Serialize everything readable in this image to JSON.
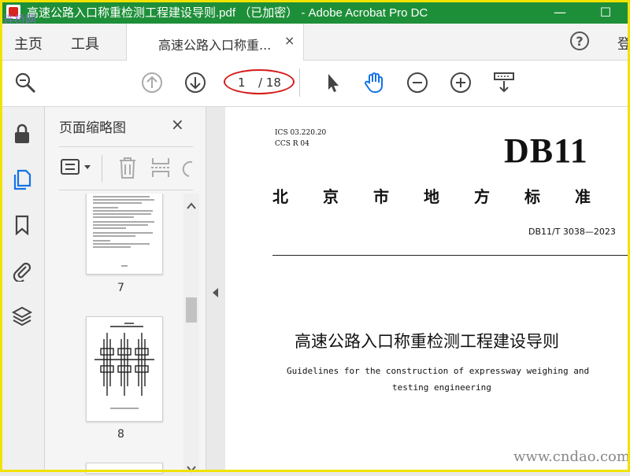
{
  "window": {
    "title": "高速公路入口称重检测工程建设导则.pdf （已加密） - Adobe Acrobat Pro DC",
    "minimize_glyph": "—",
    "maximize_glyph": "☐",
    "watermark_overlay": "连桥网"
  },
  "tabbar": {
    "home_label": "主页",
    "tools_label": "工具",
    "doc_tab_label": "高速公路入口称重...",
    "doc_tab_close": "×",
    "help_glyph": "?",
    "login_label": "登"
  },
  "toolbar": {
    "page_current": "1",
    "page_total": "/ 18"
  },
  "thumbnails_panel": {
    "title": "页面缩略图",
    "close": "×",
    "pages": [
      {
        "number": "7"
      },
      {
        "number": "8"
      }
    ]
  },
  "document": {
    "ics": "ICS 03.220.20",
    "ccs": "CCS R 04",
    "standard_code": "DB11",
    "region_standard": "北京市地方标准",
    "standard_number": "DB11/T 3038—2023",
    "title_cn": "高速公路入口称重检测工程建设导则",
    "title_en_line1": "Guidelines  for the  construction  of  expressway weighing and",
    "title_en_line2": "testing engineering"
  },
  "site_watermark": "www.cndao.com",
  "colors": {
    "titlebar": "#1e8f39",
    "border_highlight": "#f2e200",
    "annotation_oval": "#d41b1b",
    "active_tool": "#1473e6"
  }
}
